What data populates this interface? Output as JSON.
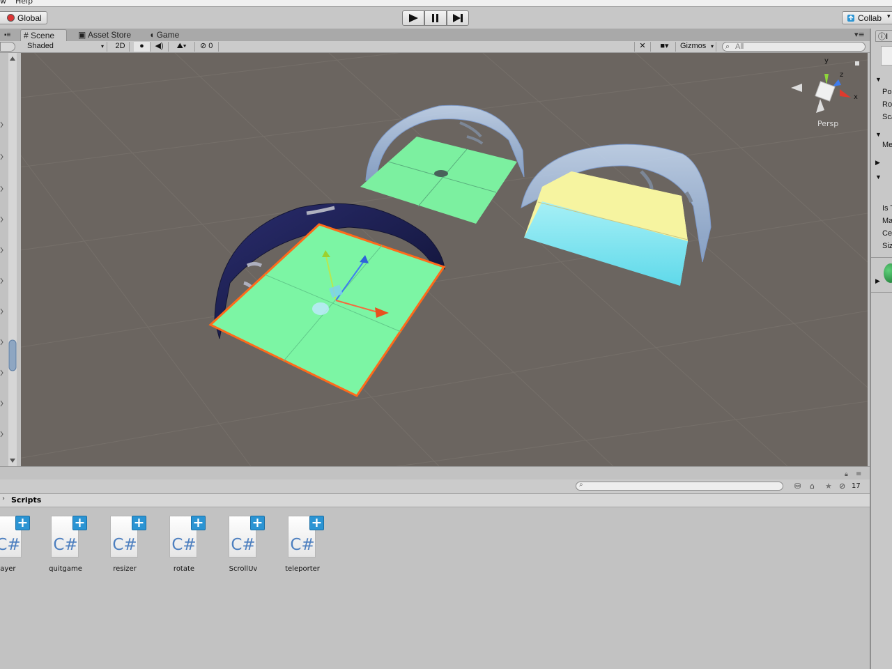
{
  "menu": {
    "item_view": "w",
    "item_help": "Help"
  },
  "toolbar": {
    "global_label": "Global",
    "collab_label": "Collab",
    "inspector_tab_partial": "I"
  },
  "scene_tabs": [
    {
      "label": "Scene",
      "icon": "hash-icon",
      "active": true
    },
    {
      "label": "Asset Store",
      "icon": "store-icon",
      "active": false
    },
    {
      "label": "Game",
      "icon": "pacman-icon",
      "active": false
    }
  ],
  "scene_bar": {
    "shading_mode": "Shaded",
    "mode_2d": "2D",
    "hidden_count": "0",
    "gizmos_label": "Gizmos",
    "search_placeholder": "All"
  },
  "scene_gizmo": {
    "projection": "Persp",
    "axis_x": "x",
    "axis_y": "y",
    "axis_z": "z"
  },
  "inspector": {
    "labels": [
      "Pos",
      "Rot",
      "Sca",
      "Me",
      "Is T",
      "Ma",
      "Ce",
      "Siz"
    ]
  },
  "project": {
    "folder": "Scripts",
    "visible_count": "17",
    "assets": [
      {
        "name": "layer",
        "type": "C#"
      },
      {
        "name": "quitgame",
        "type": "C#"
      },
      {
        "name": "resizer",
        "type": "C#"
      },
      {
        "name": "rotate",
        "type": "C#"
      },
      {
        "name": "ScrollUv",
        "type": "C#"
      },
      {
        "name": "teleporter",
        "type": "C#"
      }
    ]
  },
  "colors": {
    "viewport_bg": "#6b6560",
    "plane_green": "#7cf0a0",
    "selection_outline": "#ff6a1a",
    "sand_yellow": "#f6f4a0",
    "water_cyan": "#7fe6f2",
    "dome_dark": "#1f2256",
    "dome_glass": "#a9c6ec",
    "accent_blue": "#2b94d3"
  }
}
